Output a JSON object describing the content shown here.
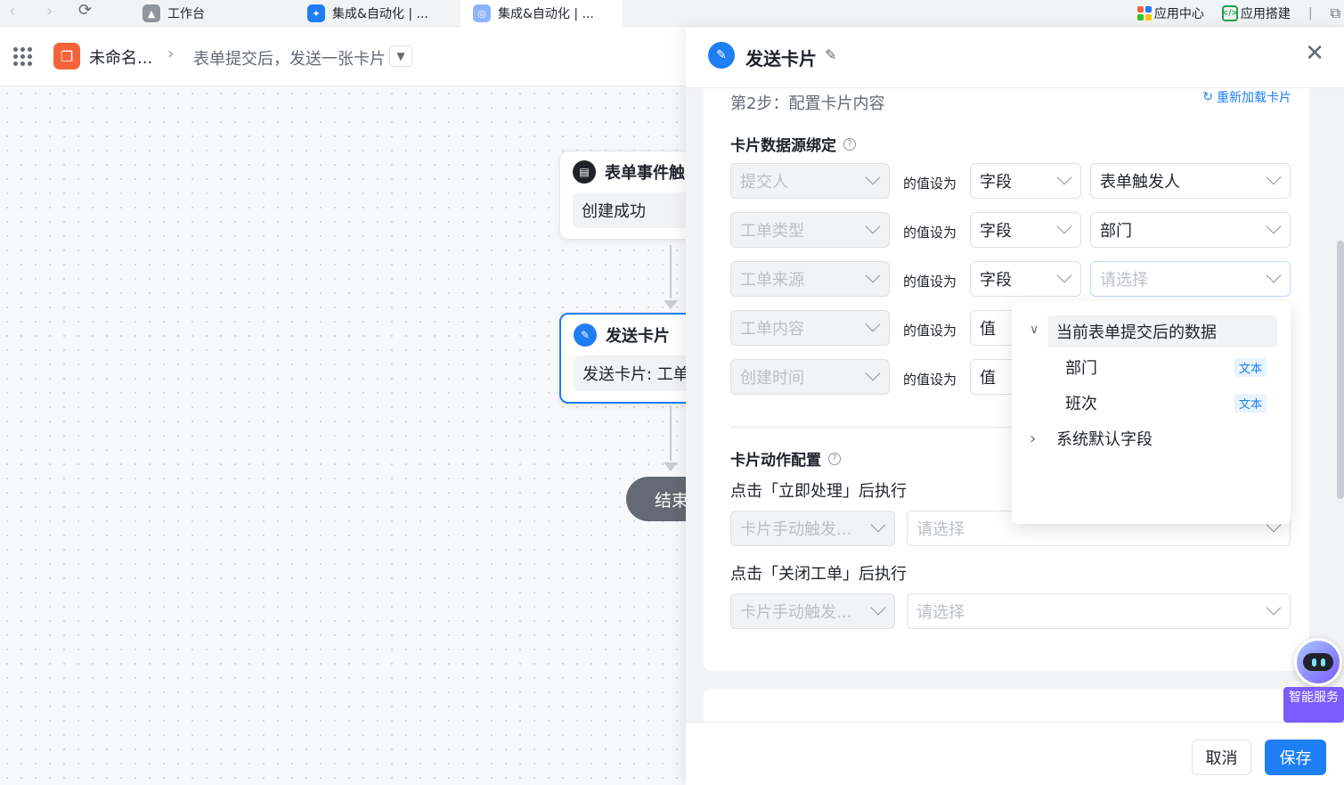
{
  "browser": {
    "tabs": [
      {
        "label": "工作台",
        "icon": "workbench-icon"
      },
      {
        "label": "集成&自动化 | ...",
        "icon": "feishu-icon"
      },
      {
        "label": "集成&自动化 | ...",
        "icon": "app-icon"
      }
    ],
    "right_items": {
      "app_center": "应用中心",
      "app_builder": "应用搭建",
      "separator": "|"
    }
  },
  "header": {
    "app_name": "未命名...",
    "breadcrumb": "表单提交后，发送一张卡片"
  },
  "canvas": {
    "trigger_node": {
      "title": "表单事件触",
      "body": "创建成功"
    },
    "send_node": {
      "title": "发送卡片",
      "body": "发送卡片: 工单"
    },
    "end_node": "结束"
  },
  "drawer": {
    "title": "发送卡片",
    "step_title": "第2步：配置卡片内容",
    "reload_label": "重新加载卡片",
    "datasource_title": "卡片数据源绑定",
    "mapping_label": "的值设为",
    "rows": [
      {
        "field": "提交人",
        "type": "字段",
        "value": "表单触发人",
        "placeholder": false
      },
      {
        "field": "工单类型",
        "type": "字段",
        "value": "部门",
        "placeholder": false
      },
      {
        "field": "工单来源",
        "type": "字段",
        "value": "请选择",
        "placeholder": true
      },
      {
        "field": "工单内容",
        "type": "值",
        "value": "",
        "placeholder": false
      },
      {
        "field": "创建时间",
        "type": "值",
        "value": "",
        "placeholder": false
      }
    ],
    "action_title": "卡片动作配置",
    "actions": [
      {
        "label": "点击「立即处理」后执行",
        "trigger": "卡片手动触发...",
        "target": "请选择"
      },
      {
        "label": "点击「关闭工单」后执行",
        "trigger": "卡片手动触发...",
        "target": "请选择"
      }
    ],
    "popup": {
      "group1": "当前表单提交后的数据",
      "items": [
        {
          "label": "部门",
          "tag": "文本"
        },
        {
          "label": "班次",
          "tag": "文本"
        }
      ],
      "group2": "系统默认字段"
    },
    "footer": {
      "cancel": "取消",
      "save": "保存"
    }
  },
  "assistant": {
    "label": "智能服务"
  },
  "colors": {
    "accent": "#1d7ef5",
    "brand_orange": "#f5633a",
    "assistant": "#7b5cff"
  }
}
